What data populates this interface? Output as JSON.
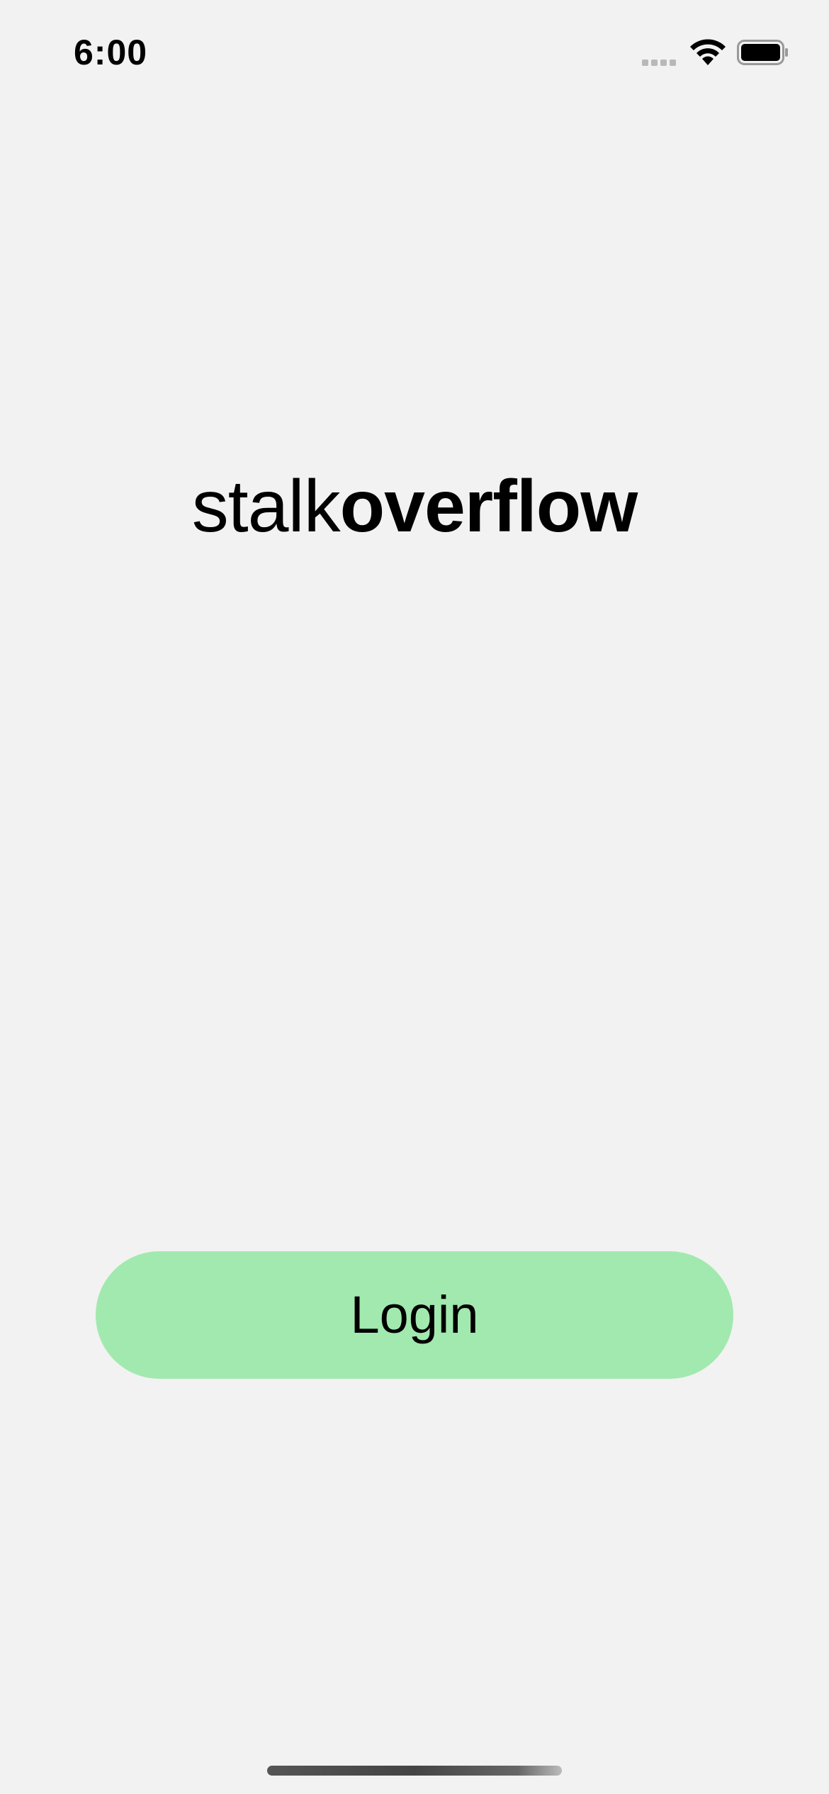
{
  "status_bar": {
    "time": "6:00",
    "icons": [
      "signal-icon",
      "wifi-icon",
      "battery-icon"
    ]
  },
  "brand": {
    "light": "stalk",
    "bold": "overflow"
  },
  "login_button": {
    "label": "Login",
    "color": "#a1e9ae"
  },
  "background_color": "#f2f2f2"
}
